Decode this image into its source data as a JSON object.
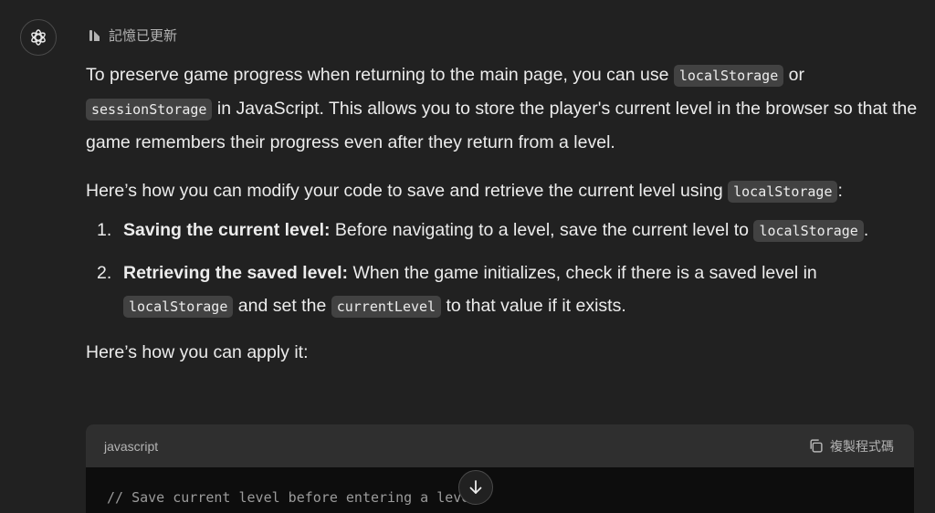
{
  "memory": {
    "label": "記憶已更新"
  },
  "message": {
    "p1": {
      "t1": "To preserve game progress when returning to the main page, you can use ",
      "c1": "localStorage",
      "t2": " or ",
      "c2": "sessionStorage",
      "t3": " in JavaScript. This allows you to store the player's current level in the browser so that the game remembers their progress even after they return from a level."
    },
    "p2": {
      "t1": "Here’s how you can modify your code to save and retrieve the current level using ",
      "c1": "localStorage",
      "t2": ":"
    },
    "list": [
      {
        "num": "1.",
        "bold": "Saving the current level:",
        "t1": " Before navigating to a level, save the current level to ",
        "c1": "localStorage",
        "t2": "."
      },
      {
        "num": "2.",
        "bold": "Retrieving the saved level:",
        "t1": " When the game initializes, check if there is a saved level in ",
        "c1": "localStorage",
        "t2": " and set the ",
        "c2": "currentLevel",
        "t3": " to that value if it exists."
      }
    ],
    "p3": "Here’s how you can apply it:"
  },
  "codeblock": {
    "language": "javascript",
    "copy_label": "複製程式碼",
    "line1": "// Save current level before entering a level"
  },
  "icons": {
    "avatar": "openai-logo-icon",
    "memory": "memory-updated-icon",
    "copy": "copy-icon",
    "scroll": "arrow-down-icon"
  }
}
